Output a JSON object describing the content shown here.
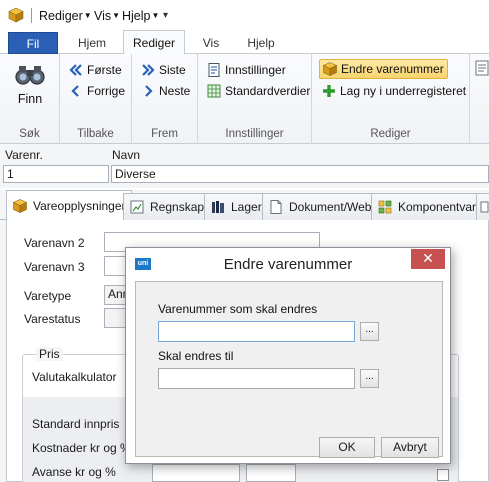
{
  "quick_access": {
    "menus": [
      "Rediger",
      "Vis",
      "Hjelp"
    ]
  },
  "ribbon_tabs": {
    "file": "Fil",
    "tabs": [
      "Hjem",
      "Rediger",
      "Vis",
      "Hjelp"
    ],
    "active": "Rediger"
  },
  "ribbon": {
    "sok": {
      "label": "Søk",
      "finn": "Finn"
    },
    "tilbake": {
      "label": "Tilbake",
      "forste": "Første",
      "forrige": "Forrige"
    },
    "frem": {
      "label": "Frem",
      "siste": "Siste",
      "neste": "Neste"
    },
    "innstillinger": {
      "label": "Innstillinger",
      "innstillinger_btn": "Innstillinger",
      "standardverdier": "Standardverdier"
    },
    "rediger": {
      "label": "Rediger",
      "endre": "Endre varenummer",
      "legg_til": "Lag ny i underregisteret"
    }
  },
  "form": {
    "varenr_label": "Varenr.",
    "varenr_value": "1",
    "navn_label": "Navn",
    "navn_value": "Diverse"
  },
  "content_tabs": [
    "Vareopplysninger",
    "Regnskap",
    "Lager",
    "Dokument/Web",
    "Komponentvare"
  ],
  "vareopplysninger": {
    "varenavn2": "Varenavn 2",
    "varenavn3": "Varenavn 3",
    "varetype": "Varetype",
    "varetype_value": "Anr",
    "varestatus": "Varestatus",
    "pris_group": "Pris",
    "valutakalkulator": "Valutakalkulator",
    "standard_innpris": "Standard innpris",
    "kostnader": "Kostnader kr og  %",
    "avanse": "Avanse kr og %"
  },
  "dialog": {
    "title": "Endre varenummer",
    "logo": "uni",
    "close": "✕",
    "label_from": "Varenummer som skal endres",
    "value_from": "",
    "label_to": "Skal endres til",
    "value_to": "",
    "dots": "...",
    "ok": "OK",
    "cancel": "Avbryt"
  },
  "colors": {
    "file_tab": "#2a5fb6",
    "close_button": "#c75050",
    "highlight": "#f8d46c",
    "focus_border": "#7aa7d8"
  }
}
